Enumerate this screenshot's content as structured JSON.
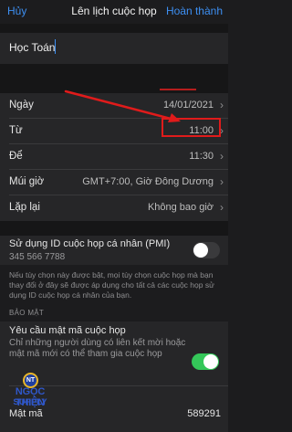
{
  "nav": {
    "cancel_label": "Hủy",
    "title": "Lên lịch cuộc họp",
    "done_label": "Hoàn thành"
  },
  "topic": {
    "value": "Học Toán"
  },
  "rows": {
    "date": {
      "label": "Ngày",
      "value": "14/01/2021"
    },
    "from": {
      "label": "Từ",
      "value": "11:00"
    },
    "to": {
      "label": "Để",
      "value": "11:30"
    },
    "timezone": {
      "label": "Múi giờ",
      "value": "GMT+7:00, Giờ Đông Dương"
    },
    "repeat": {
      "label": "Lặp lại",
      "value": "Không bao giờ"
    }
  },
  "pmi": {
    "label": "Sử dụng ID cuộc họp cá nhân (PMI)",
    "id": "345 566 7788",
    "enabled": false
  },
  "pmi_note": "Nếu tùy chọn này được bật, mọi tùy chọn cuộc họp mà bạn thay đổi ở đây sẽ được áp dụng cho tất cả các cuộc họp sử dụng ID cuộc họp cá nhân của bạn.",
  "security": {
    "section_title": "BẢO MẬT",
    "password_label": "Yêu cầu mật mã cuộc họp",
    "password_desc": "Chỉ những người dùng có liên kết mời hoặc mật mã mới có thể tham gia cuộc họp",
    "password_enabled": true
  },
  "passcode": {
    "label": "Mật mã",
    "value": "589291"
  },
  "watermark": {
    "line1": "NGỌC THIỆN",
    "line2": "SUPPLY",
    "badge": "NT"
  },
  "colors": {
    "accent": "#3d8ff2",
    "toggle_on": "#34c759",
    "annotation_red": "#e01b1b",
    "background": "#1c1c1e",
    "cell": "#262628"
  },
  "icons": {
    "row_chevron": "chevron-right-icon"
  }
}
